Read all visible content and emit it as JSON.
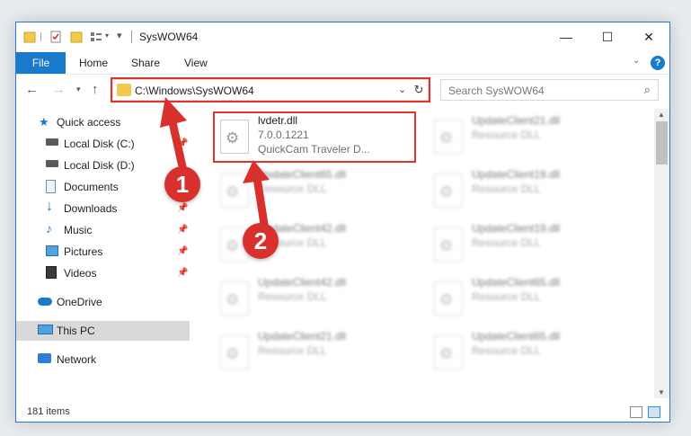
{
  "window": {
    "title": "SysWOW64",
    "controls": {
      "minimize": "—",
      "maximize": "☐",
      "close": "✕"
    }
  },
  "ribbon": {
    "file": "File",
    "tabs": [
      "Home",
      "Share",
      "View"
    ],
    "help": "?"
  },
  "nav": {
    "address": "C:\\Windows\\SysWOW64",
    "search_placeholder": "Search SysWOW64"
  },
  "sidebar": {
    "items": [
      {
        "label": "Quick access",
        "icon": "star-icon"
      },
      {
        "label": "Local Disk (C:)",
        "icon": "drive-icon",
        "pinned": true
      },
      {
        "label": "Local Disk (D:)",
        "icon": "drive-icon"
      },
      {
        "label": "Documents",
        "icon": "documents-icon"
      },
      {
        "label": "Downloads",
        "icon": "download-icon",
        "pinned": true
      },
      {
        "label": "Music",
        "icon": "music-icon",
        "pinned": true
      },
      {
        "label": "Pictures",
        "icon": "pictures-icon",
        "pinned": true
      },
      {
        "label": "Videos",
        "icon": "videos-icon",
        "pinned": true
      },
      {
        "label": "OneDrive",
        "icon": "cloud-icon"
      },
      {
        "label": "This PC",
        "icon": "computer-icon",
        "selected": true
      },
      {
        "label": "Network",
        "icon": "network-icon"
      }
    ]
  },
  "files": [
    {
      "name": "lvdetr.dll",
      "line1": "7.0.0.1221",
      "line2": "QuickCam Traveler D...",
      "highlighted": true
    },
    {
      "name": "UpdateClient21.dll",
      "line1": "Resource DLL"
    },
    {
      "name": "UpdateClient65.dll",
      "line1": "Resource DLL"
    },
    {
      "name": "UpdateClient19.dll",
      "line1": "Resource DLL"
    },
    {
      "name": "UpdateClient42.dll",
      "line1": "Resource DLL"
    },
    {
      "name": "UpdateClient19.dll",
      "line1": "Resource DLL"
    },
    {
      "name": "UpdateClient42.dll",
      "line1": "Resource DLL"
    },
    {
      "name": "UpdateClient65.dll",
      "line1": "Resource DLL"
    },
    {
      "name": "UpdateClient21.dll",
      "line1": "Resource DLL"
    },
    {
      "name": "UpdateClient65.dll",
      "line1": "Resource DLL"
    }
  ],
  "status": {
    "item_count": "181 items"
  },
  "annotations": {
    "step1": "1",
    "step2": "2",
    "color": "#d8302c"
  }
}
